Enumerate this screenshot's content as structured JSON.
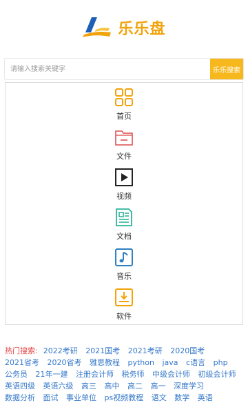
{
  "brand": {
    "name": "乐乐盘"
  },
  "search": {
    "placeholder": "请输入搜索关键字",
    "button_label": "乐乐搜索"
  },
  "nav": {
    "items": [
      {
        "label": "首页",
        "icon": "grid-icon"
      },
      {
        "label": "文件",
        "icon": "folder-icon"
      },
      {
        "label": "视频",
        "icon": "video-play-icon"
      },
      {
        "label": "文档",
        "icon": "document-icon"
      },
      {
        "label": "音乐",
        "icon": "music-note-icon"
      },
      {
        "label": "软件",
        "icon": "download-tray-icon"
      }
    ]
  },
  "hot": {
    "title": "热门搜索:",
    "tags": [
      "2022考研",
      "2021国考",
      "2021考研",
      "2020国考",
      "2021省考",
      "2020省考",
      "雅思教程",
      "python",
      "java",
      "c语言",
      "php",
      "公务员",
      "21年一建",
      "注册会计师",
      "税务师",
      "中级会计师",
      "初级会计师",
      "英语四级",
      "英语六级",
      "高三",
      "高中",
      "高二",
      "高一",
      "深度学习",
      "数据分析",
      "面试",
      "事业单位",
      "ps视频教程",
      "语文",
      "数学",
      "英语"
    ]
  },
  "colors": {
    "accent": "#f7b81d",
    "brand_blue": "#1f5fb8",
    "hot_title": "#e54545",
    "tag": "#3578c9"
  }
}
